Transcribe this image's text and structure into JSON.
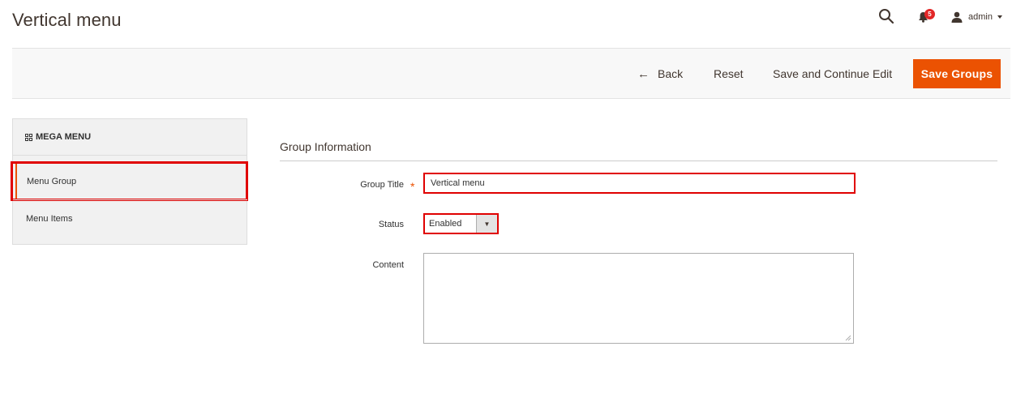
{
  "header": {
    "title": "Vertical menu",
    "notification_count": "5",
    "user_name": "admin"
  },
  "toolbar": {
    "back_label": "Back",
    "reset_label": "Reset",
    "continue_label": "Save and Continue Edit",
    "save_label": "Save Groups"
  },
  "sidebar": {
    "title": "MEGA MENU",
    "items": [
      {
        "label": "Menu Group",
        "active": true
      },
      {
        "label": "Menu Items",
        "active": false
      }
    ]
  },
  "form": {
    "section_title": "Group Information",
    "group_title_label": "Group Title",
    "required_mark": "*",
    "group_title_value": "Vertical menu",
    "status_label": "Status",
    "status_value": "Enabled",
    "content_label": "Content",
    "content_value": ""
  },
  "colors": {
    "accent": "#eb5202",
    "highlight_border": "#e00000",
    "badge": "#e22626"
  },
  "icons": [
    "search-icon",
    "bell-icon",
    "user-icon",
    "caret-down-icon",
    "back-arrow-icon",
    "grid-icon",
    "select-arrow-icon"
  ]
}
